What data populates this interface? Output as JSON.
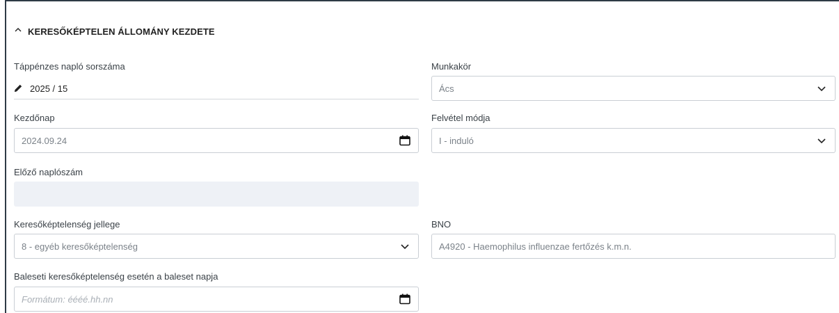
{
  "section": {
    "title": "KERESŐKÉPTELEN ÁLLOMÁNY KEZDETE",
    "icon": "chevron-up-icon"
  },
  "fields": {
    "naplo_sorszam": {
      "label": "Táppénzes napló sorszáma",
      "value": "2025 / 15",
      "icon": "pencil-icon"
    },
    "munkakor": {
      "label": "Munkakör",
      "value": "Ács",
      "icon": "chevron-down-icon"
    },
    "kezdonap": {
      "label": "Kezdőnap",
      "value": "2024.09.24",
      "icon": "calendar-icon"
    },
    "felvetel_modja": {
      "label": "Felvétel módja",
      "value": "I - induló",
      "icon": "chevron-down-icon"
    },
    "elozo_naploszam": {
      "label": "Előző naplószám",
      "value": ""
    },
    "jelleg": {
      "label": "Keresőképtelenség jellege",
      "value": "8 - egyéb keresőképtelenség",
      "icon": "chevron-down-icon"
    },
    "bno": {
      "label": "BNO",
      "value": "A4920 - Haemophilus influenzae fertőzés k.m.n."
    },
    "baleset_napja": {
      "label": "Baleseti keresőképtelenség esetén a baleset napja",
      "placeholder": "Formátum: éééé.hh.nn",
      "icon": "calendar-icon"
    }
  },
  "colors": {
    "border": "#c9ced4",
    "disabled_bg": "#eef1f6",
    "panel_edge": "#2e3a46"
  }
}
